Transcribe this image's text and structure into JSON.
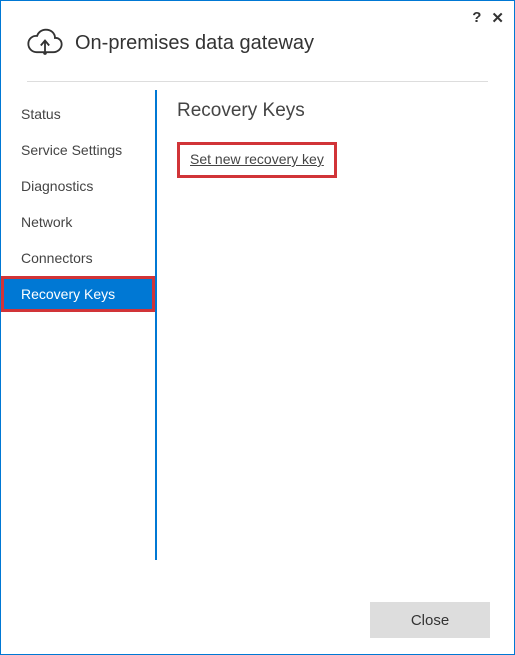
{
  "header": {
    "title": "On-premises data gateway",
    "help_glyph": "?",
    "close_glyph": "✕"
  },
  "sidebar": {
    "items": [
      {
        "label": "Status",
        "active": false
      },
      {
        "label": "Service Settings",
        "active": false
      },
      {
        "label": "Diagnostics",
        "active": false
      },
      {
        "label": "Network",
        "active": false
      },
      {
        "label": "Connectors",
        "active": false
      },
      {
        "label": "Recovery Keys",
        "active": true
      }
    ]
  },
  "content": {
    "heading": "Recovery Keys",
    "link_label": "Set new recovery key"
  },
  "footer": {
    "close_label": "Close"
  }
}
